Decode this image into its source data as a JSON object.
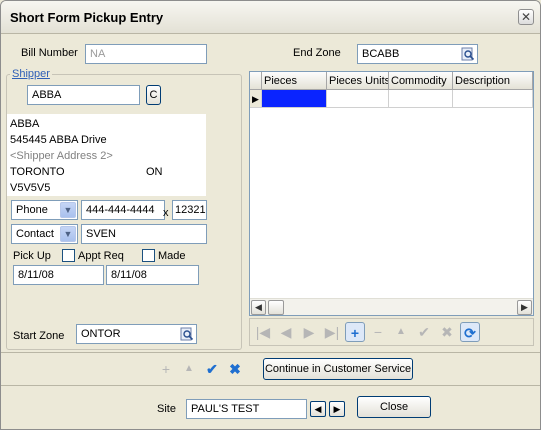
{
  "window": {
    "title": "Short Form Pickup Entry",
    "close_glyph": "✕"
  },
  "bill": {
    "label": "Bill Number",
    "value": "NA"
  },
  "end_zone": {
    "label": "End Zone",
    "value": "BCABB"
  },
  "shipper": {
    "group_label": "Shipper",
    "code": "ABBA",
    "c_button": "C",
    "address_lines": [
      "ABBA",
      "545445 ABBA Drive",
      "<Shipper Address 2>"
    ],
    "city": "TORONTO",
    "province": "ON",
    "postal": "V5V5V5",
    "phone_type": "Phone",
    "phone": "444-444-4444",
    "ext_label": "x",
    "ext": "12321",
    "contact_type": "Contact",
    "contact": "SVEN",
    "pickup_label": "Pick Up",
    "appt_req_label": "Appt Req",
    "made_label": "Made",
    "pickup_date1": "8/11/08",
    "pickup_date2": "8/11/08"
  },
  "start_zone": {
    "label": "Start Zone",
    "value": "ONTOR"
  },
  "grid": {
    "columns": [
      "Pieces",
      "Pieces Units",
      "Commodity",
      "Description"
    ],
    "row_indicator": "▶"
  },
  "nav": {
    "first": "|◀",
    "prev": "◀",
    "next": "▶",
    "last": "▶|",
    "add": "+",
    "remove": "−",
    "up": "▲",
    "post": "✔",
    "cancel": "✖",
    "refresh": "⟳"
  },
  "bottom_tools": {
    "add": "+",
    "up": "▲",
    "ok": "✔",
    "cancel": "✖"
  },
  "continue_button": "Continue in Customer Service",
  "site": {
    "label": "Site",
    "value": "PAUL'S TEST",
    "prev": "◀",
    "next": "▶"
  },
  "close_button": "Close"
}
